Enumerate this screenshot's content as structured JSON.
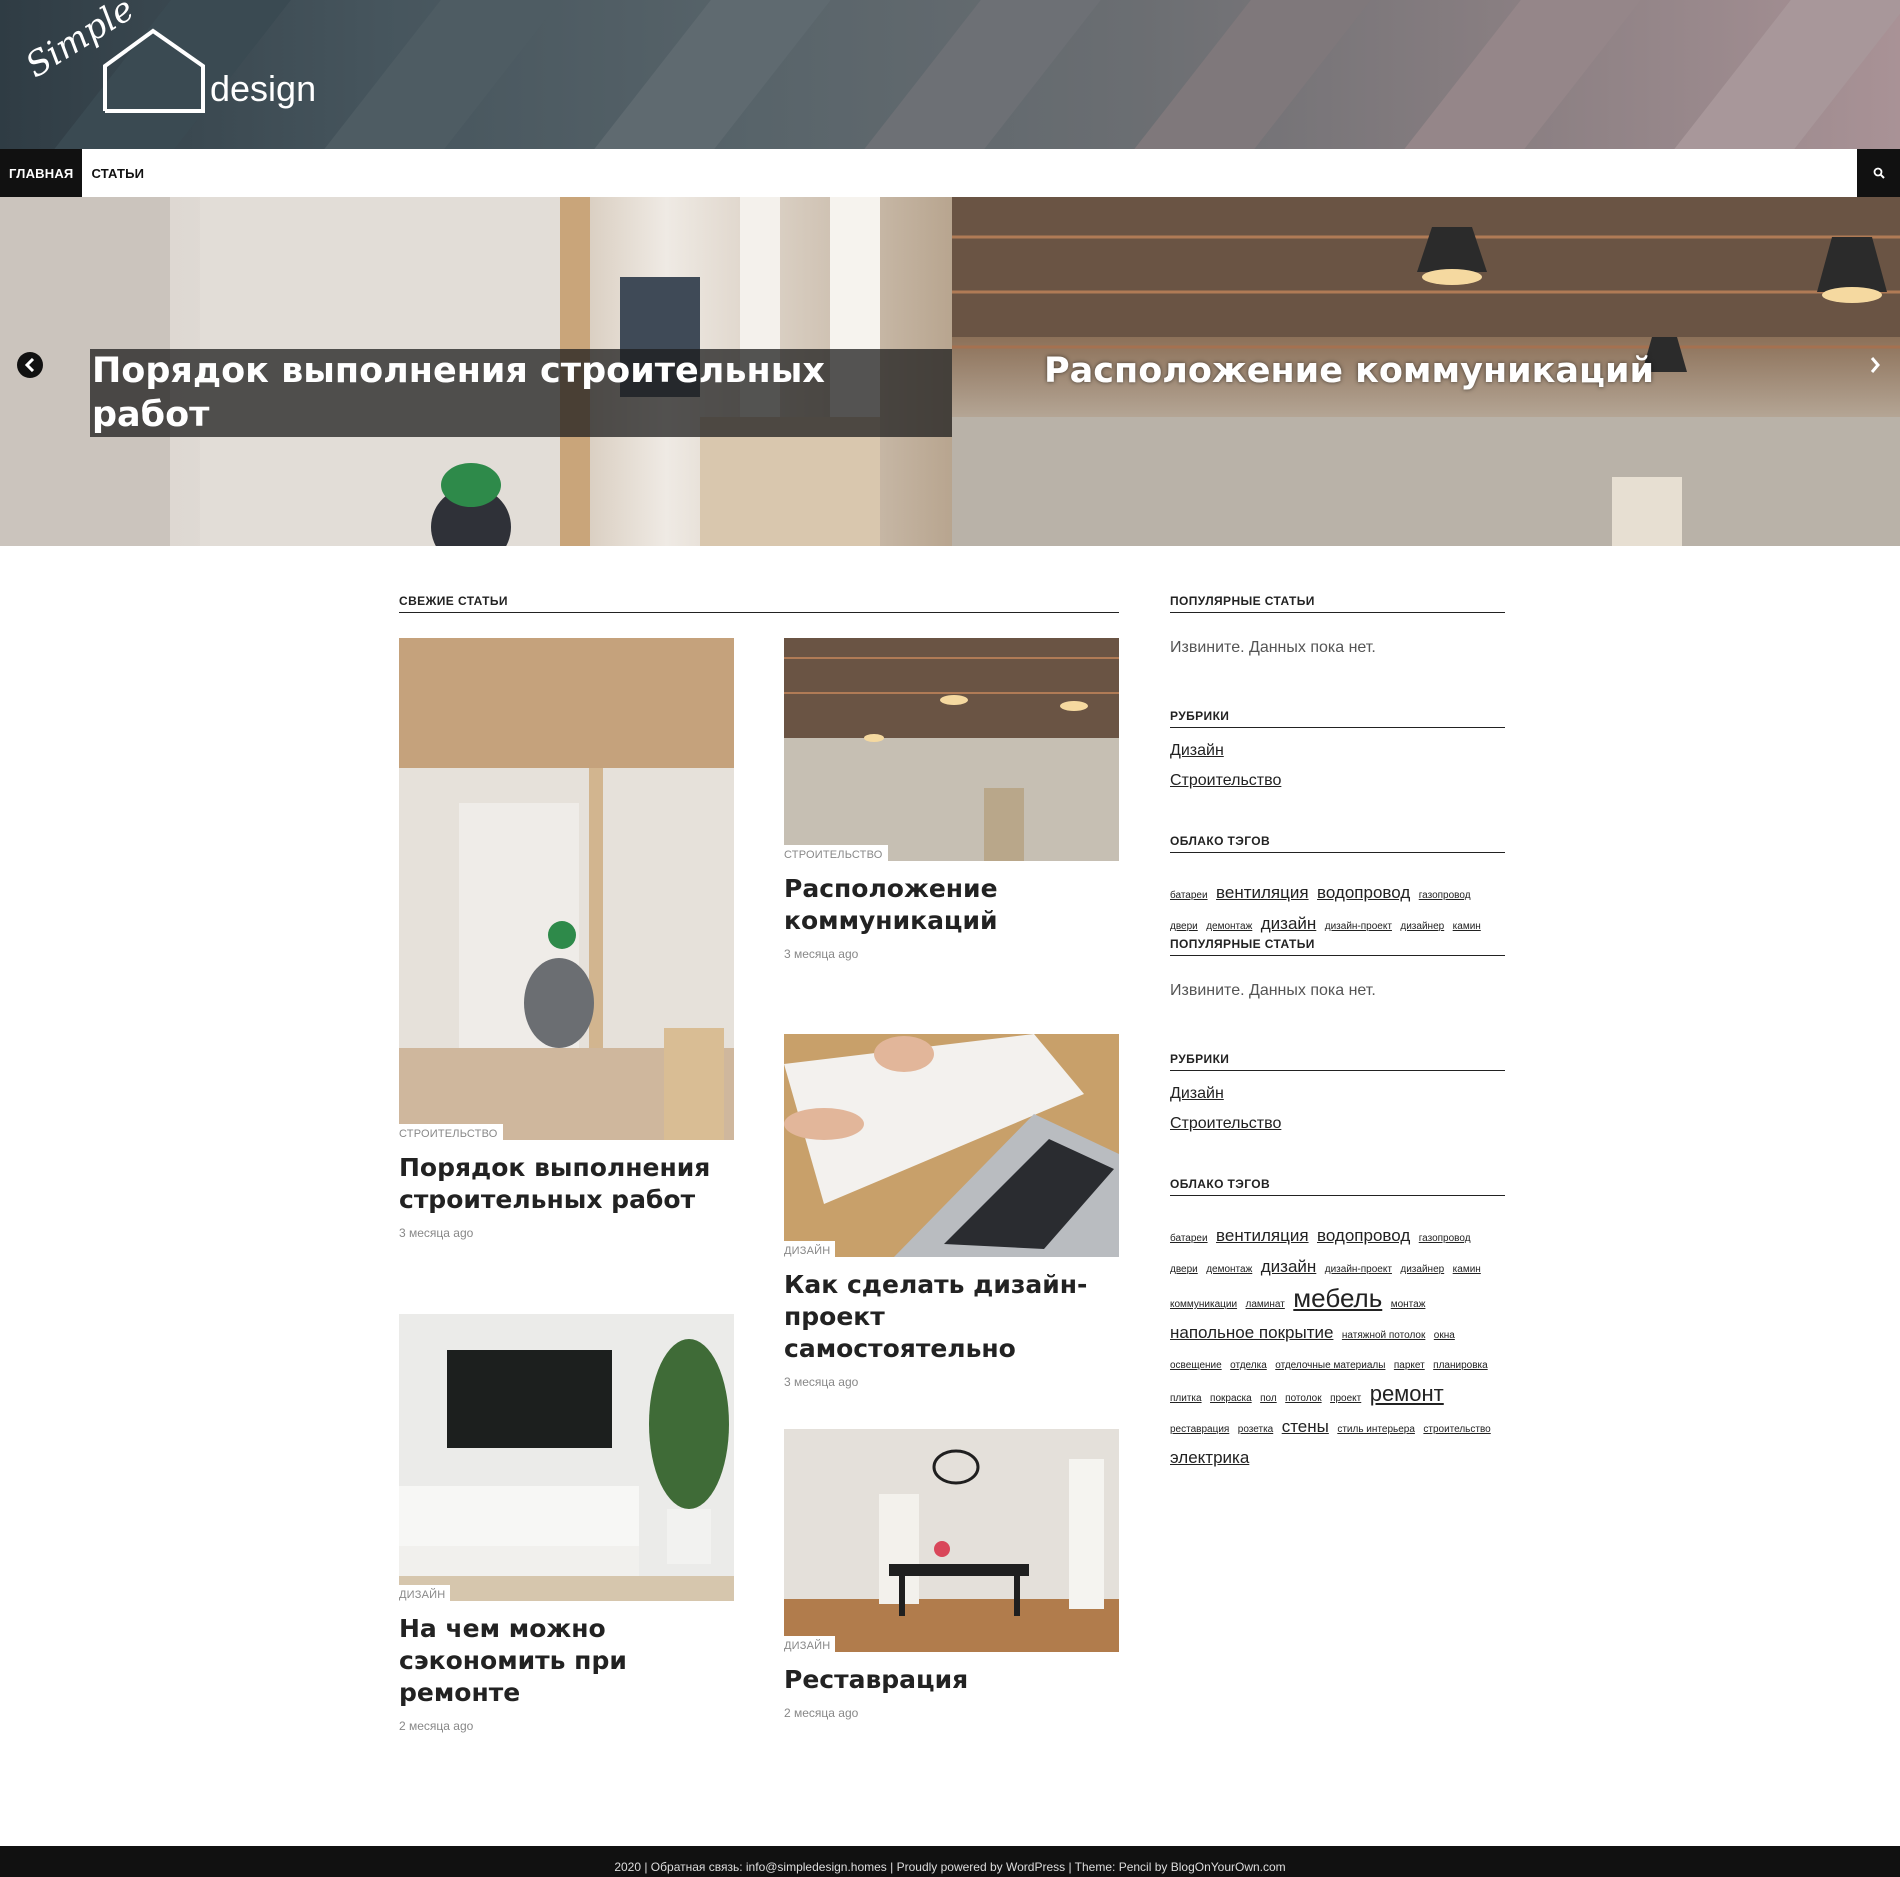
{
  "header": {
    "logo_script": "Simple",
    "logo_word": "design"
  },
  "nav": {
    "items": [
      {
        "label": "ГЛАВНАЯ",
        "active": true
      },
      {
        "label": "СТАТЬИ",
        "active": false
      }
    ],
    "search_icon": "search-icon"
  },
  "slider": {
    "slides": [
      {
        "title": "Порядок выполнения строительных работ"
      },
      {
        "title": "Расположение коммуникаций"
      }
    ],
    "prev_icon": "chevron-left-icon",
    "next_icon": "chevron-right-icon"
  },
  "main": {
    "section_title": "СВЕЖИЕ СТАТЬИ",
    "posts": [
      {
        "category": "СТРОИТЕЛЬСТВО",
        "title": "Порядок выполнения строительных работ",
        "date": "3 месяца ago"
      },
      {
        "category": "СТРОИТЕЛЬСТВО",
        "title": "Расположение коммуникаций",
        "date": "3 месяца ago"
      },
      {
        "category": "ДИЗАЙН",
        "title": "Как сделать дизайн-проект самостоятельно",
        "date": "3 месяца ago"
      },
      {
        "category": "ДИЗАЙН",
        "title": "На чем можно сэкономить при ремонте",
        "date": "2 месяца ago"
      },
      {
        "category": "ДИЗАЙН",
        "title": "Реставрация",
        "date": "2 месяца ago"
      }
    ]
  },
  "sidebar": {
    "popular_title": "ПОПУЛЯРНЫЕ СТАТЬИ",
    "popular_empty": "Извините. Данных пока нет.",
    "categories_title": "РУБРИКИ",
    "categories": [
      "Дизайн",
      "Строительство"
    ],
    "tags_title": "ОБЛАКО ТЭГОВ",
    "tags_partial": [
      {
        "t": "батареи",
        "s": 10
      },
      {
        "t": "вентиляция",
        "s": 17
      },
      {
        "t": "водопровод",
        "s": 17
      },
      {
        "t": "газопровод",
        "s": 10
      },
      {
        "t": "двери",
        "s": 10
      },
      {
        "t": "демонтаж",
        "s": 10
      },
      {
        "t": "дизайн",
        "s": 17
      },
      {
        "t": "дизайн-проект",
        "s": 10
      },
      {
        "t": "дизайнер",
        "s": 10
      },
      {
        "t": "камин",
        "s": 10
      }
    ],
    "tags": [
      {
        "t": "батареи",
        "s": 10
      },
      {
        "t": "вентиляция",
        "s": 17
      },
      {
        "t": "водопровод",
        "s": 17
      },
      {
        "t": "газопровод",
        "s": 10
      },
      {
        "t": "двери",
        "s": 10
      },
      {
        "t": "демонтаж",
        "s": 10
      },
      {
        "t": "дизайн",
        "s": 17
      },
      {
        "t": "дизайн-проект",
        "s": 10
      },
      {
        "t": "дизайнер",
        "s": 10
      },
      {
        "t": "камин",
        "s": 10
      },
      {
        "t": "коммуникации",
        "s": 10
      },
      {
        "t": "ламинат",
        "s": 10
      },
      {
        "t": "мебель",
        "s": 26
      },
      {
        "t": "монтаж",
        "s": 10
      },
      {
        "t": "напольное покрытие",
        "s": 17
      },
      {
        "t": "натяжной потолок",
        "s": 10
      },
      {
        "t": "окна",
        "s": 10
      },
      {
        "t": "освещение",
        "s": 10
      },
      {
        "t": "отделка",
        "s": 10
      },
      {
        "t": "отделочные материалы",
        "s": 10
      },
      {
        "t": "паркет",
        "s": 10
      },
      {
        "t": "планировка",
        "s": 10
      },
      {
        "t": "плитка",
        "s": 10
      },
      {
        "t": "покраска",
        "s": 10
      },
      {
        "t": "пол",
        "s": 10
      },
      {
        "t": "потолок",
        "s": 10
      },
      {
        "t": "проект",
        "s": 10
      },
      {
        "t": "ремонт",
        "s": 22
      },
      {
        "t": "реставрация",
        "s": 10
      },
      {
        "t": "розетка",
        "s": 10
      },
      {
        "t": "стены",
        "s": 17
      },
      {
        "t": "стиль интерьера",
        "s": 10
      },
      {
        "t": "строительство",
        "s": 10
      },
      {
        "t": "электрика",
        "s": 17
      }
    ]
  },
  "footer": {
    "text": "2020 | Обратная связь: info@simpledesign.homes | Proudly powered by WordPress | Theme: Pencil by BlogOnYourOwn.com"
  }
}
